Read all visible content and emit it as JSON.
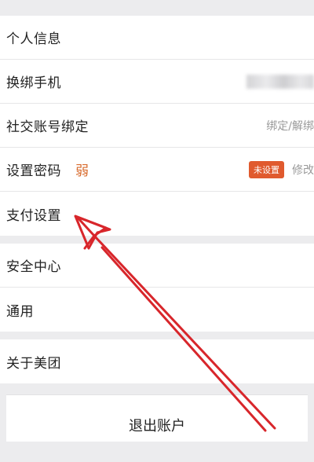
{
  "settings": {
    "personal_info": "个人信息",
    "change_phone": "换绑手机",
    "social_binding": "社交账号绑定",
    "social_binding_value": "绑定/解绑",
    "set_password": "设置密码",
    "password_strength": "弱",
    "password_status_badge": "未设置",
    "password_action": "修改",
    "payment_settings": "支付设置",
    "security_center": "安全中心",
    "general": "通用",
    "about": "关于美团",
    "logout": "退出账户"
  },
  "colors": {
    "annotation_arrow": "#d8262b",
    "badge": "#e05a2e",
    "weak_text": "#d86a2c"
  }
}
